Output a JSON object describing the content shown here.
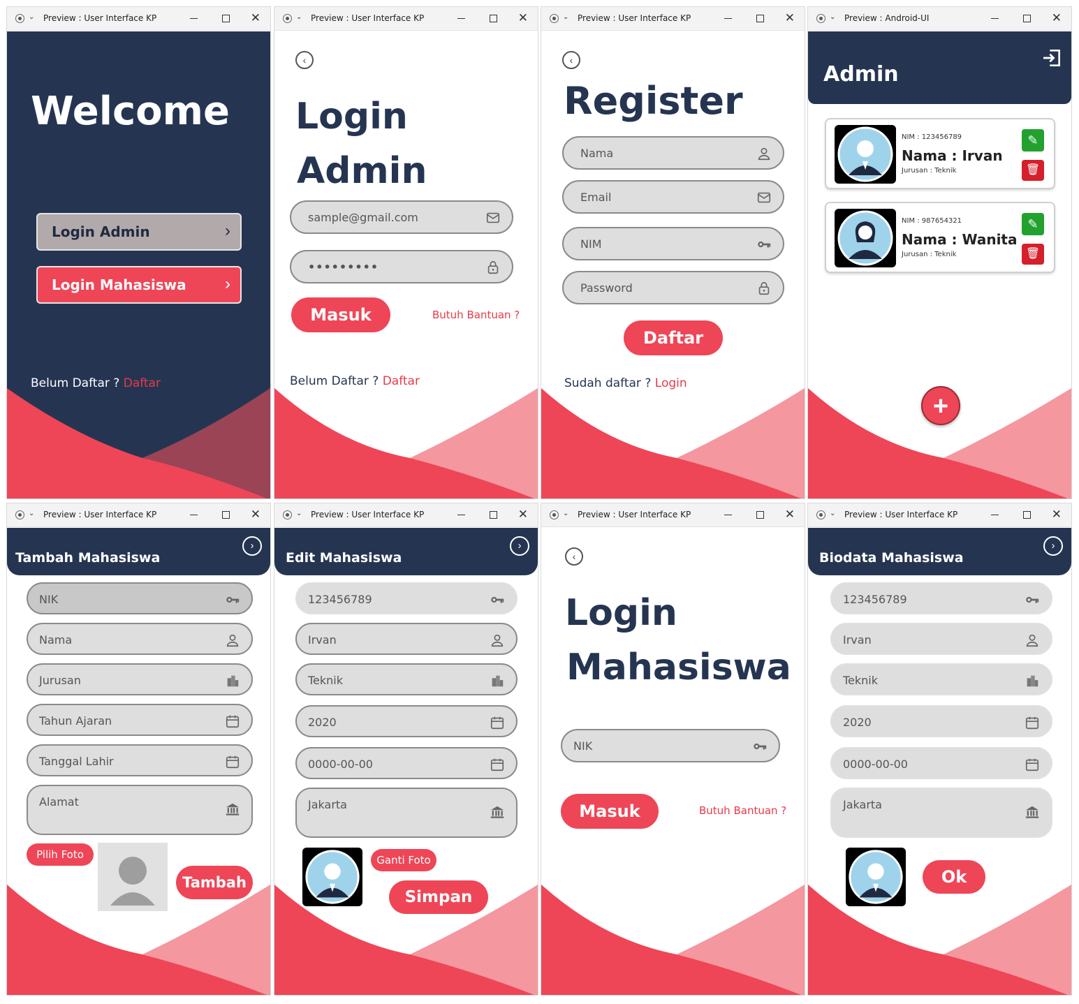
{
  "colors": {
    "navy": "#253551",
    "red": "#ee4657",
    "pink": "#f4979f",
    "green": "#22a12f"
  },
  "icons": [
    "back-arrow-icon",
    "chevron-right-icon",
    "mail-icon",
    "lock-icon",
    "user-icon",
    "key-icon",
    "building-icon",
    "calendar-icon",
    "bank-icon",
    "logout-icon",
    "edit-icon",
    "delete-icon",
    "plus-icon"
  ],
  "welcome": {
    "window_title": "Preview : User Interface KP",
    "heading": "Welcome",
    "btn_admin": "Login Admin",
    "btn_mahasiswa": "Login Mahasiswa",
    "footer_prefix": "Belum Daftar ?",
    "footer_link": "Daftar"
  },
  "login_admin": {
    "window_title": "Preview : User Interface KP",
    "heading1": "Login",
    "heading2": "Admin",
    "email_value": "sample@gmail.com",
    "password_value": "•••••••••",
    "submit": "Masuk",
    "help": "Butuh Bantuan ?",
    "footer_prefix": "Belum Daftar ?",
    "footer_link": "Daftar"
  },
  "register": {
    "window_title": "Preview : User Interface KP",
    "heading": "Register",
    "fields": [
      "Nama",
      "Email",
      "NIM",
      "Password"
    ],
    "submit": "Daftar",
    "footer_prefix": "Sudah daftar ?",
    "footer_link": "Login"
  },
  "admin": {
    "window_title": "Preview : Android-UI",
    "heading": "Admin",
    "cards": [
      {
        "nim": "NIM : 123456789",
        "nama": "Nama : Irvan",
        "jurusan": "Jurusan : Teknik"
      },
      {
        "nim": "NIM : 987654321",
        "nama": "Nama : Wanita",
        "jurusan": "Jurusan : Teknik"
      }
    ]
  },
  "tambah": {
    "window_title": "Preview : User Interface KP",
    "heading": "Tambah Mahasiswa",
    "fields": [
      "NIK",
      "Nama",
      "Jurusan",
      "Tahun Ajaran",
      "Tanggal Lahir",
      "Alamat"
    ],
    "pick_photo": "Pilih Foto",
    "submit": "Tambah"
  },
  "edit": {
    "window_title": "Preview : User Interface KP",
    "heading": "Edit Mahasiswa",
    "fields": [
      "123456789",
      "Irvan",
      "Teknik",
      "2020",
      "0000-00-00",
      "Jakarta"
    ],
    "change_photo": "Ganti Foto",
    "submit": "Simpan"
  },
  "login_mhs": {
    "window_title": "Preview : User Interface KP",
    "heading1": "Login",
    "heading2": "Mahasiswa",
    "nik_placeholder": "NIK",
    "submit": "Masuk",
    "help": "Butuh Bantuan ?"
  },
  "biodata": {
    "window_title": "Preview : User Interface KP",
    "heading": "Biodata Mahasiswa",
    "fields": [
      "123456789",
      "Irvan",
      "Teknik",
      "2020",
      "0000-00-00",
      "Jakarta"
    ],
    "ok": "Ok"
  }
}
